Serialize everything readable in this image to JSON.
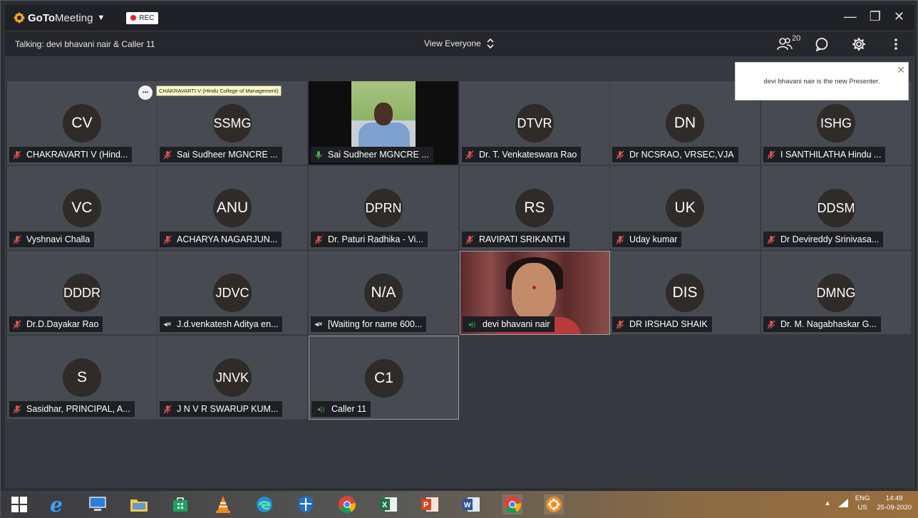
{
  "app": {
    "brand_bold": "GoTo",
    "brand_light": "Meeting",
    "rec_label": "REC"
  },
  "toolbar": {
    "talking": "Talking: devi bhavani nair & Caller 11",
    "view": "View Everyone",
    "participant_count": "20"
  },
  "notification": "devi bhavani nair is the new Presenter.",
  "tooltip": "CHAKRAVARTI V (Hindu College of Management)",
  "tiles": [
    {
      "initials": "CV",
      "name": "CHAKRAVARTI V (Hind...",
      "mic": "muted"
    },
    {
      "initials": "SSMG",
      "name": "Sai Sudheer MGNCRE ...",
      "mic": "muted"
    },
    {
      "initials": "",
      "name": "Sai Sudheer MGNCRE ...",
      "mic": "speaking",
      "video": true
    },
    {
      "initials": "DTVR",
      "name": "Dr. T. Venkateswara Rao",
      "mic": "muted"
    },
    {
      "initials": "DN",
      "name": "Dr NCSRAO, VRSEC,VJA",
      "mic": "muted"
    },
    {
      "initials": "ISHG",
      "name": "I SANTHILATHA Hindu ...",
      "mic": "muted"
    },
    {
      "initials": "VC",
      "name": "Vyshnavi Challa",
      "mic": "muted"
    },
    {
      "initials": "ANU",
      "name": "ACHARYA NAGARJUN...",
      "mic": "muted"
    },
    {
      "initials": "DPRN",
      "name": "Dr. Paturi Radhika - Vi...",
      "mic": "muted"
    },
    {
      "initials": "RS",
      "name": "RAVIPATI SRIKANTH",
      "mic": "muted"
    },
    {
      "initials": "UK",
      "name": "Uday kumar",
      "mic": "muted"
    },
    {
      "initials": "DDSM",
      "name": "Dr Devireddy Srinivasa...",
      "mic": "muted"
    },
    {
      "initials": "DDDR",
      "name": "Dr.D.Dayakar Rao",
      "mic": "muted"
    },
    {
      "initials": "JDVC",
      "name": "J.d.venkatesh Aditya en...",
      "mic": "phone"
    },
    {
      "initials": "N/A",
      "name": "[Waiting for name 600...",
      "mic": "phone"
    },
    {
      "initials": "",
      "name": "devi bhavani nair",
      "mic": "audio",
      "video": true
    },
    {
      "initials": "DIS",
      "name": "DR IRSHAD SHAIK",
      "mic": "muted"
    },
    {
      "initials": "DMNG",
      "name": "Dr. M. Nagabhaskar  G...",
      "mic": "muted"
    },
    {
      "initials": "S",
      "name": "Sasidhar, PRINCIPAL, A...",
      "mic": "muted"
    },
    {
      "initials": "JNVK",
      "name": "J N V R SWARUP KUM...",
      "mic": "muted"
    },
    {
      "initials": "C1",
      "name": "Caller 11",
      "mic": "audio"
    }
  ],
  "taskbar": {
    "lang_top": "ENG",
    "lang_bottom": "US",
    "time": "14:49",
    "date": "25-09-2020"
  }
}
